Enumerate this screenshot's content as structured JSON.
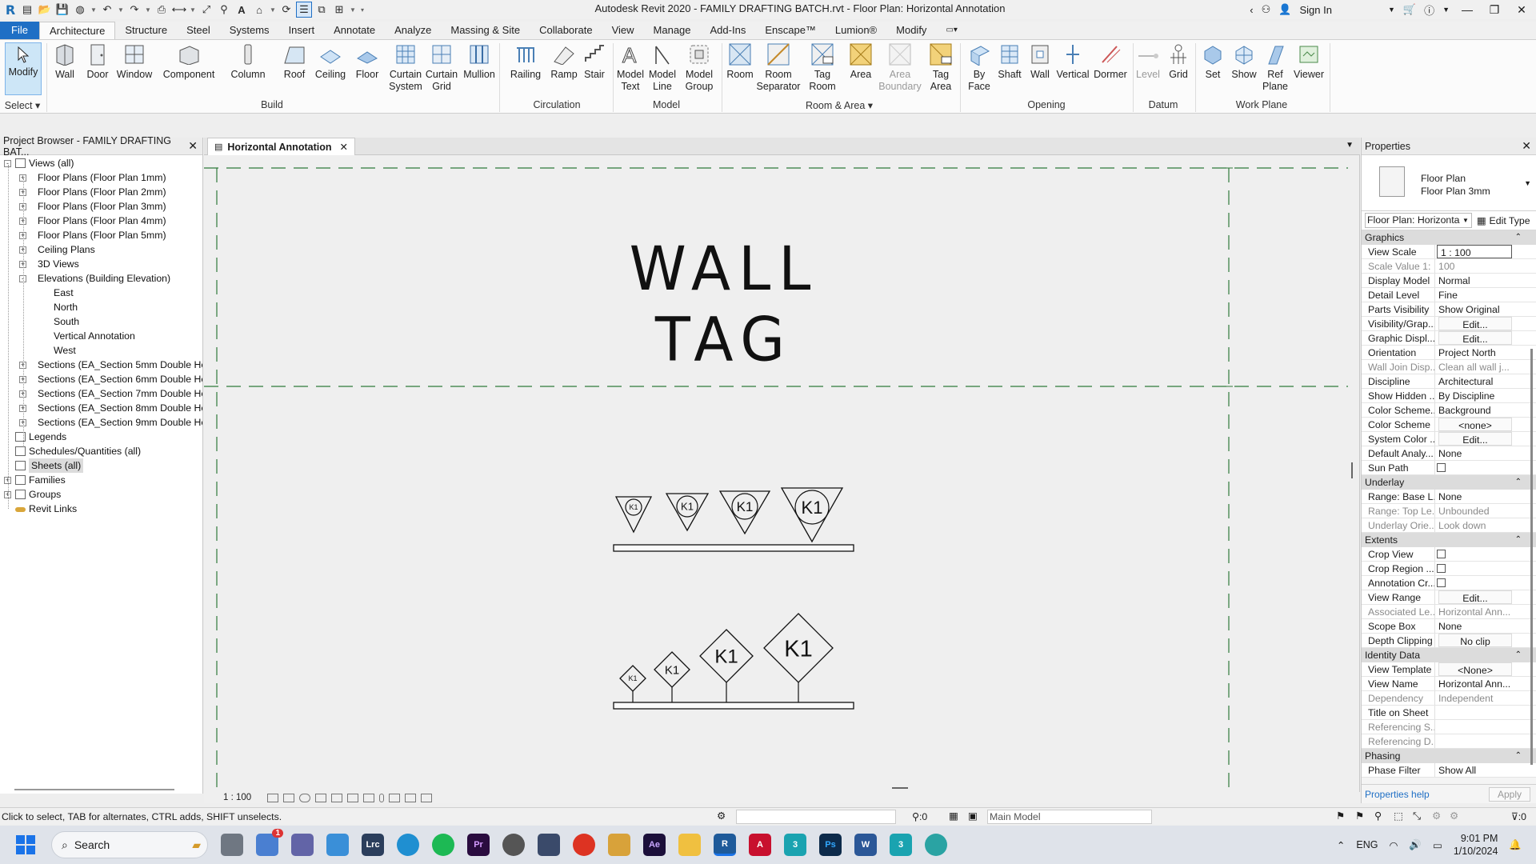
{
  "window": {
    "title": "Autodesk Revit 2020 - FAMILY DRAFTING BATCH.rvt - Floor Plan: Horizontal Annotation",
    "sign_in": "Sign In"
  },
  "tabs": [
    "File",
    "Architecture",
    "Structure",
    "Steel",
    "Systems",
    "Insert",
    "Annotate",
    "Analyze",
    "Massing & Site",
    "Collaborate",
    "View",
    "Manage",
    "Add-Ins",
    "Enscape™",
    "Lumion®",
    "Modify"
  ],
  "active_tab": "Architecture",
  "ribbon": {
    "modify": "Modify",
    "select_label": "Select",
    "build": {
      "label": "Build",
      "wall": "Wall",
      "door": "Door",
      "window": "Window",
      "component": "Component",
      "column": "Column",
      "roof": "Roof",
      "ceiling": "Ceiling",
      "floor": "Floor",
      "curtain_system": [
        "Curtain",
        "System"
      ],
      "curtain_grid": [
        "Curtain",
        "Grid"
      ],
      "mullion": "Mullion"
    },
    "circulation": {
      "label": "Circulation",
      "railing": "Railing",
      "ramp": "Ramp",
      "stair": "Stair"
    },
    "model": {
      "label": "Model",
      "model_text": [
        "Model",
        "Text"
      ],
      "model_line": [
        "Model",
        "Line"
      ],
      "model_group": [
        "Model",
        "Group"
      ]
    },
    "room_area": {
      "label": "Room & Area",
      "room": "Room",
      "room_separator": [
        "Room",
        "Separator"
      ],
      "tag_room": [
        "Tag",
        "Room"
      ],
      "area": "Area",
      "area_boundary": [
        "Area",
        "Boundary"
      ],
      "tag_area": [
        "Tag",
        "Area"
      ]
    },
    "opening": {
      "label": "Opening",
      "by_face": [
        "By",
        "Face"
      ],
      "shaft": "Shaft",
      "wall": "Wall",
      "vertical": "Vertical",
      "dormer": "Dormer"
    },
    "datum": {
      "label": "Datum",
      "level": "Level",
      "grid": "Grid"
    },
    "work_plane": {
      "label": "Work Plane",
      "set": "Set",
      "show": "Show",
      "ref_plane": [
        "Ref",
        "Plane"
      ],
      "viewer": "Viewer"
    }
  },
  "browser": {
    "title": "Project Browser - FAMILY DRAFTING BAT...",
    "items": [
      {
        "label": "Views (all)",
        "level": 0,
        "exp": "-",
        "icon": "views"
      },
      {
        "label": "Floor Plans (Floor Plan 1mm)",
        "level": 1,
        "exp": "+"
      },
      {
        "label": "Floor Plans (Floor Plan 2mm)",
        "level": 1,
        "exp": "+"
      },
      {
        "label": "Floor Plans (Floor Plan 3mm)",
        "level": 1,
        "exp": "+"
      },
      {
        "label": "Floor Plans (Floor Plan 4mm)",
        "level": 1,
        "exp": "+"
      },
      {
        "label": "Floor Plans (Floor Plan 5mm)",
        "level": 1,
        "exp": "+"
      },
      {
        "label": "Ceiling Plans",
        "level": 1,
        "exp": "+"
      },
      {
        "label": "3D Views",
        "level": 1,
        "exp": "+"
      },
      {
        "label": "Elevations (Building Elevation)",
        "level": 1,
        "exp": "-"
      },
      {
        "label": "East",
        "level": 2
      },
      {
        "label": "North",
        "level": 2
      },
      {
        "label": "South",
        "level": 2
      },
      {
        "label": "Vertical Annotation",
        "level": 2
      },
      {
        "label": "West",
        "level": 2
      },
      {
        "label": "Sections (EA_Section 5mm Double Hea",
        "level": 1,
        "exp": "+"
      },
      {
        "label": "Sections (EA_Section 6mm Double Hea",
        "level": 1,
        "exp": "+"
      },
      {
        "label": "Sections (EA_Section 7mm Double Hea",
        "level": 1,
        "exp": "+"
      },
      {
        "label": "Sections (EA_Section 8mm Double Hea",
        "level": 1,
        "exp": "+"
      },
      {
        "label": "Sections (EA_Section 9mm Double Hea",
        "level": 1,
        "exp": "+"
      },
      {
        "label": "Legends",
        "level": 0,
        "icon": "legend"
      },
      {
        "label": "Schedules/Quantities (all)",
        "level": 0,
        "icon": "schedule"
      },
      {
        "label": "Sheets (all)",
        "level": 0,
        "icon": "sheet",
        "selected": true
      },
      {
        "label": "Families",
        "level": 0,
        "exp": "+",
        "icon": "family"
      },
      {
        "label": "Groups",
        "level": 0,
        "exp": "+",
        "icon": "group"
      },
      {
        "label": "Revit Links",
        "level": 0,
        "icon": "link"
      }
    ]
  },
  "view_tab": {
    "label": "Horizontal Annotation"
  },
  "canvas": {
    "title": "WALL TAG",
    "tag_text": "K1"
  },
  "viewbar": {
    "scale": "1 : 100"
  },
  "properties": {
    "title": "Properties",
    "family": "Floor Plan",
    "type": "Floor Plan 3mm",
    "instance": "Floor Plan: Horizonta",
    "edit_type": "Edit Type",
    "groups": [
      {
        "name": "Graphics",
        "rows": [
          {
            "k": "View Scale",
            "v": "1 : 100",
            "style": "edit"
          },
          {
            "k": "Scale Value    1:",
            "v": "100",
            "ro": true
          },
          {
            "k": "Display Model",
            "v": "Normal"
          },
          {
            "k": "Detail Level",
            "v": "Fine"
          },
          {
            "k": "Parts Visibility",
            "v": "Show Original"
          },
          {
            "k": "Visibility/Grap...",
            "v": "Edit...",
            "style": "btn"
          },
          {
            "k": "Graphic Displ...",
            "v": "Edit...",
            "style": "btn"
          },
          {
            "k": "Orientation",
            "v": "Project North"
          },
          {
            "k": "Wall Join Disp...",
            "v": "Clean all wall j...",
            "ro": true
          },
          {
            "k": "Discipline",
            "v": "Architectural"
          },
          {
            "k": "Show Hidden ...",
            "v": "By Discipline"
          },
          {
            "k": "Color Scheme...",
            "v": "Background"
          },
          {
            "k": "Color Scheme",
            "v": "<none>",
            "style": "btn"
          },
          {
            "k": "System Color ...",
            "v": "Edit...",
            "style": "btn"
          },
          {
            "k": "Default Analy...",
            "v": "None"
          },
          {
            "k": "Sun Path",
            "v": "",
            "style": "check"
          }
        ]
      },
      {
        "name": "Underlay",
        "rows": [
          {
            "k": "Range: Base L...",
            "v": "None"
          },
          {
            "k": "Range: Top Le...",
            "v": "Unbounded",
            "ro": true
          },
          {
            "k": "Underlay Orie...",
            "v": "Look down",
            "ro": true
          }
        ]
      },
      {
        "name": "Extents",
        "rows": [
          {
            "k": "Crop View",
            "v": "",
            "style": "check"
          },
          {
            "k": "Crop Region ...",
            "v": "",
            "style": "check"
          },
          {
            "k": "Annotation Cr...",
            "v": "",
            "style": "check"
          },
          {
            "k": "View Range",
            "v": "Edit...",
            "style": "btn"
          },
          {
            "k": "Associated Le...",
            "v": "Horizontal Ann...",
            "ro": true
          },
          {
            "k": "Scope Box",
            "v": "None"
          },
          {
            "k": "Depth Clipping",
            "v": "No clip",
            "style": "btn"
          }
        ]
      },
      {
        "name": "Identity Data",
        "rows": [
          {
            "k": "View Template",
            "v": "<None>",
            "style": "btn"
          },
          {
            "k": "View Name",
            "v": "Horizontal Ann..."
          },
          {
            "k": "Dependency",
            "v": "Independent",
            "ro": true
          },
          {
            "k": "Title on Sheet",
            "v": ""
          },
          {
            "k": "Referencing S...",
            "v": "",
            "ro": true
          },
          {
            "k": "Referencing D...",
            "v": "",
            "ro": true
          }
        ]
      },
      {
        "name": "Phasing",
        "rows": [
          {
            "k": "Phase Filter",
            "v": "Show All"
          }
        ]
      }
    ],
    "help": "Properties help",
    "apply": "Apply"
  },
  "status": {
    "hint": "Click to select, TAB for alternates, CTRL adds, SHIFT unselects.",
    "selection_count": ":0",
    "model": "Main Model",
    "filter_count": ":0"
  },
  "taskbar": {
    "search": "Search",
    "lang": "ENG",
    "time": "9:01 PM",
    "date": "1/10/2024",
    "badge": "1"
  }
}
